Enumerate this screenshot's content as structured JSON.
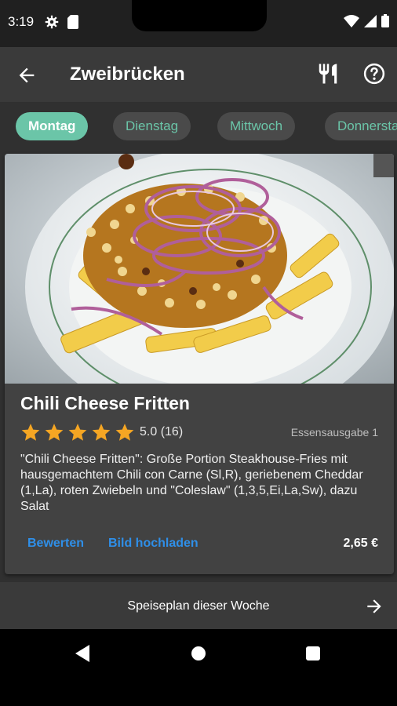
{
  "status_bar": {
    "time": "3:19",
    "icons": [
      "gear-icon",
      "sim-card-icon",
      "wifi-icon",
      "signal-icon",
      "battery-icon"
    ]
  },
  "app_bar": {
    "title": "Zweibrücken",
    "icons": [
      "back-arrow-icon",
      "fork-knife-icon",
      "help-circle-icon"
    ]
  },
  "day_tabs": [
    {
      "label": "Montag",
      "selected": true
    },
    {
      "label": "Dienstag",
      "selected": false
    },
    {
      "label": "Mittwoch",
      "selected": false
    },
    {
      "label": "Donnersta",
      "selected": false
    }
  ],
  "meal": {
    "title": "Chili Cheese Fritten",
    "rating_value": 5.0,
    "star_count": 5,
    "rating_text": "5.0 (16)",
    "location": "Essensausgabe 1",
    "description": "\"Chili Cheese Fritten\": Große Portion Steakhouse-Fries mit hausgemachtem Chili con Carne (Sl,R), geriebenem Cheddar (1,La), roten Zwiebeln und \"Coleslaw\" (1,3,5,Ei,La,Sw), dazu Salat",
    "actions": {
      "rate": "Bewerten",
      "upload": "Bild hochladen"
    },
    "price": "2,65 €"
  },
  "week_bar": {
    "label": "Speiseplan dieser Woche"
  },
  "colors": {
    "accent": "#6bc5a8",
    "link": "#2f8fe8",
    "star": "#f5a623",
    "background": "#303030",
    "card": "#424242"
  }
}
